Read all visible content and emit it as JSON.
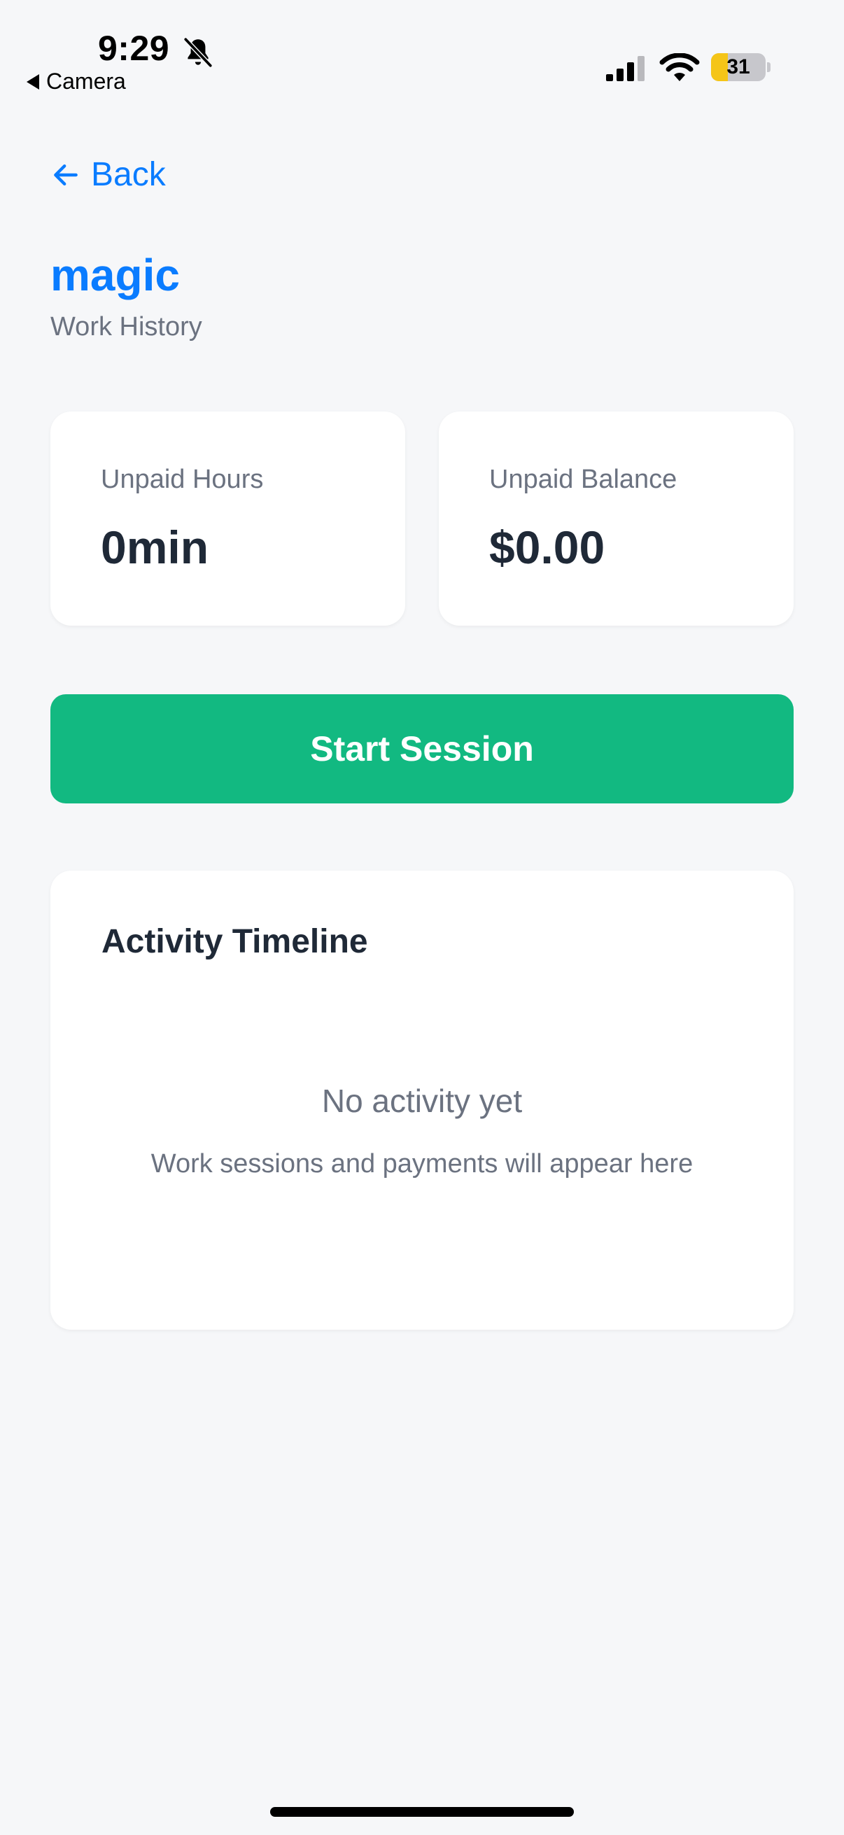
{
  "status_bar": {
    "time": "9:29",
    "back_app_label": "Camera",
    "battery_level": "31",
    "battery_fraction": 0.31,
    "battery_color": "#f5c518",
    "icons": [
      "bell-slash-icon",
      "cellular-signal-icon",
      "wifi-icon",
      "battery-icon"
    ]
  },
  "nav": {
    "back_label": "Back",
    "back_icon": "arrow-left-icon"
  },
  "header": {
    "title": "magic",
    "subtitle": "Work History"
  },
  "stats": {
    "unpaid_hours_label": "Unpaid Hours",
    "unpaid_hours_value": "0min",
    "unpaid_balance_label": "Unpaid Balance",
    "unpaid_balance_value": "$0.00"
  },
  "actions": {
    "start_session_label": "Start Session"
  },
  "timeline": {
    "title": "Activity Timeline",
    "empty_title": "No activity yet",
    "empty_description": "Work sessions and payments will appear here"
  },
  "colors": {
    "accent": "#0a7cff",
    "primary_button": "#12b981",
    "background": "#f6f7f9",
    "muted_text": "#6b7280"
  }
}
